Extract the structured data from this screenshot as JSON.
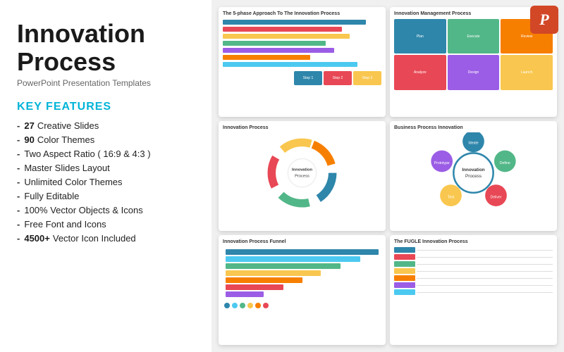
{
  "left": {
    "title": "Innovation Process",
    "subtitle": "PowerPoint Presentation Templates",
    "features_heading": "KEY FEATURES",
    "features": [
      {
        "id": "f1",
        "bold": "27",
        "text": " Creative Slides"
      },
      {
        "id": "f2",
        "bold": "90",
        "text": " Color Themes"
      },
      {
        "id": "f3",
        "bold": "",
        "text": "Two Aspect Ratio ( 16:9 & 4:3 )"
      },
      {
        "id": "f4",
        "bold": "",
        "text": "Master Slides Layout"
      },
      {
        "id": "f5",
        "bold": "",
        "text": "Unlimited Color Themes"
      },
      {
        "id": "f6",
        "bold": "",
        "text": "Fully Editable"
      },
      {
        "id": "f7",
        "bold": "",
        "text": "100% Vector Objects & Icons"
      },
      {
        "id": "f8",
        "bold": "",
        "text": "Free Font and Icons"
      },
      {
        "id": "f9",
        "bold": "4500+",
        "text": " Vector Icon Included"
      }
    ]
  },
  "ppt_icon_label": "P",
  "slides": [
    {
      "id": "s1",
      "title": "The 5-phase Approach To The Innovation Process"
    },
    {
      "id": "s2",
      "title": "Innovation Management Process"
    },
    {
      "id": "s3",
      "title": "Innovation Process"
    },
    {
      "id": "s4",
      "title": "Business Process Innovation"
    },
    {
      "id": "s5",
      "title": "Innovation Process Funnel"
    },
    {
      "id": "s6",
      "title": "The FUGLE Innovation Process"
    }
  ]
}
